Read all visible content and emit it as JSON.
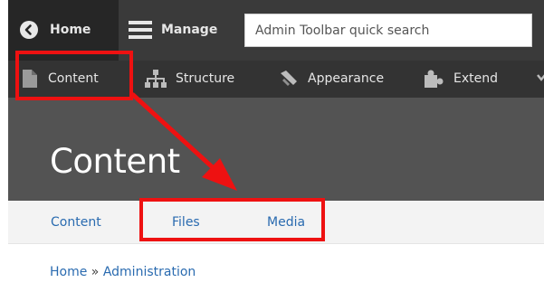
{
  "toolbar": {
    "home_label": "Home",
    "manage_label": "Manage",
    "search_placeholder": "Admin Toolbar quick search"
  },
  "tray": {
    "items": [
      {
        "label": "Content",
        "icon": "file-icon"
      },
      {
        "label": "Structure",
        "icon": "sitemap-icon"
      },
      {
        "label": "Appearance",
        "icon": "brush-icon"
      },
      {
        "label": "Extend",
        "icon": "puzzle-icon"
      }
    ]
  },
  "header": {
    "title": "Content"
  },
  "tabs": [
    {
      "label": "Content"
    },
    {
      "label": "Files"
    },
    {
      "label": "Media"
    }
  ],
  "breadcrumb": {
    "home": "Home",
    "separator": "»",
    "current": "Administration"
  },
  "colors": {
    "toolbar_bg": "#3a3a3a",
    "tray_bg": "#333333",
    "header_bg": "#535353",
    "link": "#2a6bb0",
    "annotation": "#ee1111"
  }
}
